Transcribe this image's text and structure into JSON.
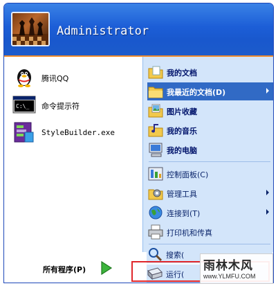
{
  "header": {
    "username": "Administrator"
  },
  "left_panel": {
    "items": [
      {
        "label": "腾讯QQ",
        "icon": "qq-penguin-icon"
      },
      {
        "label": "命令提示符",
        "icon": "command-prompt-icon"
      },
      {
        "label": "StyleBuilder.exe",
        "icon": "stylebuilder-icon"
      }
    ]
  },
  "right_panel": {
    "items": [
      {
        "label": "我的文档",
        "icon": "my-documents-icon"
      },
      {
        "label": "我最近的文档(D)",
        "icon": "recent-documents-icon",
        "has_submenu": true,
        "highlighted": true
      },
      {
        "label": "图片收藏",
        "icon": "my-pictures-icon"
      },
      {
        "label": "我的音乐",
        "icon": "my-music-icon"
      },
      {
        "label": "我的电脑",
        "icon": "my-computer-icon"
      },
      {
        "label": "控制面板(C)",
        "icon": "control-panel-icon"
      },
      {
        "label": "管理工具",
        "icon": "admin-tools-icon",
        "has_submenu": true
      },
      {
        "label": "连接到(T)",
        "icon": "connect-to-icon",
        "has_submenu": true
      },
      {
        "label": "打印机和传真",
        "icon": "printers-faxes-icon"
      },
      {
        "label": "搜索(",
        "icon": "search-icon"
      },
      {
        "label": "运行(",
        "icon": "run-icon"
      }
    ]
  },
  "bottom": {
    "all_programs_label": "所有程序(P)"
  },
  "watermark": {
    "logo": "雨林木风",
    "url": "www.YLMFU.COM"
  },
  "colors": {
    "header_blue": "#1c5ed7",
    "header_accent": "#f08b2b",
    "right_panel_bg": "#d3e5fa",
    "highlight": "#316ac5",
    "annotation_red": "#e0262a"
  }
}
